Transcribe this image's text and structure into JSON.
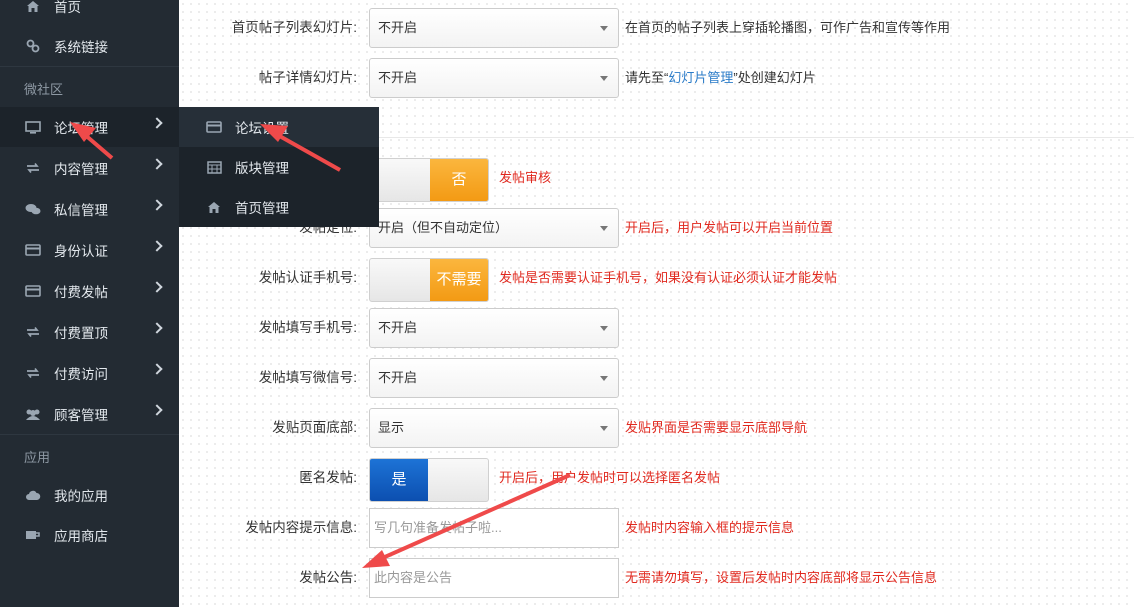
{
  "sidebar": {
    "items": [
      {
        "id": "home",
        "label": "首页",
        "icon": "home-icon"
      },
      {
        "id": "links",
        "label": "系统链接",
        "icon": "link-icon"
      },
      {
        "id": "forum",
        "label": "论坛管理",
        "icon": "monitor-icon"
      },
      {
        "id": "content",
        "label": "内容管理",
        "icon": "refresh-icon"
      },
      {
        "id": "messages",
        "label": "私信管理",
        "icon": "chat-icon"
      },
      {
        "id": "identity",
        "label": "身份认证",
        "icon": "card-icon"
      },
      {
        "id": "paid_post",
        "label": "付费发帖",
        "icon": "card-icon"
      },
      {
        "id": "paid_top",
        "label": "付费置顶",
        "icon": "refresh-icon"
      },
      {
        "id": "paid_visit",
        "label": "付费访问",
        "icon": "refresh-icon"
      },
      {
        "id": "customers",
        "label": "顾客管理",
        "icon": "users-icon"
      },
      {
        "id": "my_apps",
        "label": "我的应用",
        "icon": "cloud-icon"
      },
      {
        "id": "app_store",
        "label": "应用商店",
        "icon": "cup-icon"
      }
    ],
    "sections": {
      "micro_community": "微社区",
      "apps": "应用"
    }
  },
  "flyout": {
    "items": [
      {
        "label": "论坛设置",
        "icon": "card-icon"
      },
      {
        "label": "版块管理",
        "icon": "calendar-icon"
      },
      {
        "label": "首页管理",
        "icon": "home-icon"
      }
    ]
  },
  "form": {
    "home_slider": {
      "label": "首页帖子列表幻灯片:",
      "value": "不开启",
      "hint": "在首页的帖子列表上穿插轮播图，可作广告和宣传等作用"
    },
    "detail_slider": {
      "label": "帖子详情幻灯片:",
      "value": "不开启",
      "hint_pre": "请先至“",
      "hint_link": "幻灯片管理",
      "hint_post": "”处创建幻灯片"
    },
    "post_review": {
      "label": "",
      "toggle": "否",
      "hint": "发帖审核"
    },
    "post_location": {
      "label": "发帖定位:",
      "value": "开启（但不自动定位）",
      "hint": "开启后，用户发帖可以开启当前位置"
    },
    "phone_verify": {
      "label": "发帖认证手机号:",
      "toggle": "不需要",
      "hint": "发帖是否需要认证手机号，如果没有认证必须认证才能发帖"
    },
    "fill_phone": {
      "label": "发帖填写手机号:",
      "value": "不开启"
    },
    "fill_wechat": {
      "label": "发帖填写微信号:",
      "value": "不开启"
    },
    "page_bottom": {
      "label": "发贴页面底部:",
      "value": "显示",
      "hint": "发贴界面是否需要显示底部导航"
    },
    "anonymous": {
      "label": "匿名发帖:",
      "toggle": "是",
      "hint": "开启后，用户发帖时可以选择匿名发帖"
    },
    "content_hint": {
      "label": "发帖内容提示信息:",
      "placeholder": "写几句准备发帖子啦...",
      "hint": "发帖时内容输入框的提示信息"
    },
    "announcement": {
      "label": "发帖公告:",
      "placeholder": "此内容是公告",
      "hint": "无需请勿填写，设置后发帖时内容底部将显示公告信息"
    }
  },
  "colors": {
    "sidebar_bg": "#232b33",
    "toggle_orange": "#f39a14",
    "toggle_blue": "#0c4fb0",
    "hint_red": "#e0281e",
    "link_blue": "#2a7bc8",
    "annotation_red": "#ef4a4a"
  }
}
